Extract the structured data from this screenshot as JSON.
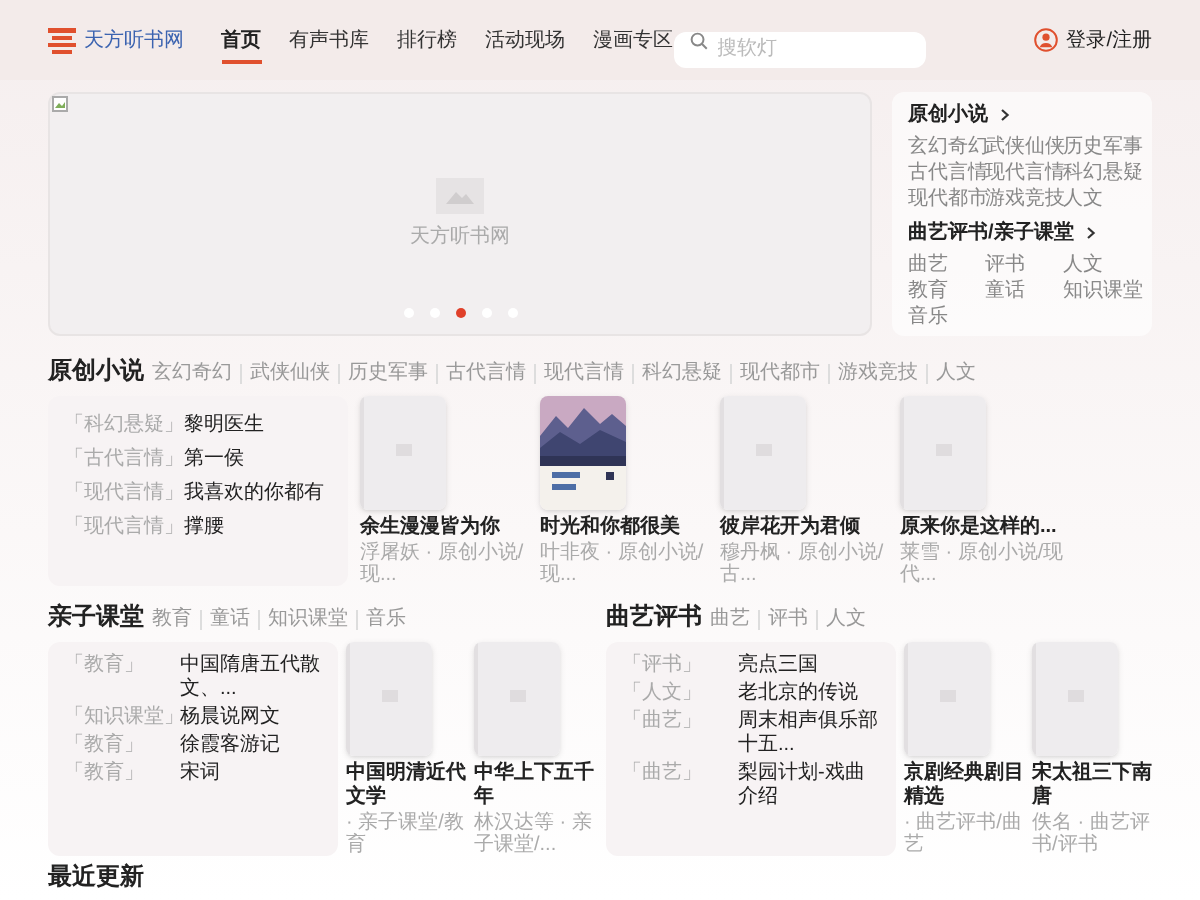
{
  "header": {
    "logo_text": "天方听书网",
    "nav": [
      {
        "label": "首页",
        "selected": true
      },
      {
        "label": "有声书库",
        "selected": false
      },
      {
        "label": "排行榜",
        "selected": false
      },
      {
        "label": "活动现场",
        "selected": false
      },
      {
        "label": "漫画专区",
        "selected": false
      }
    ],
    "search": {
      "placeholder": "搜软灯"
    },
    "login": "登录/注册"
  },
  "banner": {
    "placeholder_text": "天方听书网",
    "dots": [
      {
        "selected": false
      },
      {
        "selected": false
      },
      {
        "selected": true
      },
      {
        "selected": false
      },
      {
        "selected": false
      }
    ]
  },
  "side_panel": [
    {
      "title": "原创小说",
      "tags": [
        "玄幻奇幻",
        "武侠仙侠",
        "历史军事",
        "古代言情",
        "现代言情",
        "科幻悬疑",
        "现代都市",
        "游戏竞技",
        "人文"
      ]
    },
    {
      "title": "曲艺评书/亲子课堂",
      "tags": [
        "曲艺",
        "评书",
        "人文",
        "教育",
        "童话",
        "知识课堂",
        "音乐"
      ]
    }
  ],
  "sections": [
    {
      "kind": "full",
      "title": "原创小说",
      "tags": [
        "玄幻奇幻",
        "武侠仙侠",
        "历史军事",
        "古代言情",
        "现代言情",
        "科幻悬疑",
        "现代都市",
        "游戏竞技",
        "人文"
      ],
      "list": [
        {
          "category": "「科幻悬疑」",
          "title": "黎明医生"
        },
        {
          "category": "「古代言情」",
          "title": "第一侯"
        },
        {
          "category": "「现代言情」",
          "title": "我喜欢的你都有"
        },
        {
          "category": "「现代言情」",
          "title": "撑腰"
        }
      ],
      "books": [
        {
          "kind": "placeholder",
          "title": "余生漫漫皆为你",
          "subtitle": "浮屠妖 · 原创小说/现..."
        },
        {
          "kind": "picture",
          "title": "时光和你都很美",
          "subtitle": "叶非夜 · 原创小说/现..."
        },
        {
          "kind": "placeholder",
          "title": "彼岸花开为君倾",
          "subtitle": "穆丹枫 · 原创小说/古..."
        },
        {
          "kind": "placeholder",
          "title": "原来你是这样的...",
          "subtitle": "莱雪 · 原创小说/现代..."
        }
      ]
    },
    {
      "kind": "half",
      "title": "亲子课堂",
      "tags": [
        "教育",
        "童话",
        "知识课堂",
        "音乐"
      ],
      "list": [
        {
          "category": "「教育」",
          "title": "中国隋唐五代散文、..."
        },
        {
          "category": "「知识课堂」",
          "title": "杨晨说网文"
        },
        {
          "category": "「教育」",
          "title": "徐霞客游记"
        },
        {
          "category": "「教育」",
          "title": "宋词"
        }
      ],
      "books": [
        {
          "kind": "placeholder",
          "title": "中国明清近代文学",
          "subtitle": "· 亲子课堂/教育"
        },
        {
          "kind": "placeholder",
          "title": "中华上下五千年",
          "subtitle": "林汉达等 · 亲子课堂/..."
        }
      ]
    },
    {
      "kind": "half",
      "title": "曲艺评书",
      "tags": [
        "曲艺",
        "评书",
        "人文"
      ],
      "list": [
        {
          "category": "「评书」",
          "title": "亮点三国"
        },
        {
          "category": "「人文」",
          "title": "老北京的传说"
        },
        {
          "category": "「曲艺」",
          "title": "周末相声俱乐部十五..."
        },
        {
          "category": "「曲艺」",
          "title": "梨园计划-戏曲介绍"
        }
      ],
      "books": [
        {
          "kind": "placeholder",
          "title": "京剧经典剧目精选",
          "subtitle": "· 曲艺评书/曲艺"
        },
        {
          "kind": "placeholder",
          "title": "宋太祖三下南唐",
          "subtitle": "佚名 · 曲艺评书/评书"
        }
      ]
    }
  ],
  "recent": {
    "title": "最近更新"
  }
}
